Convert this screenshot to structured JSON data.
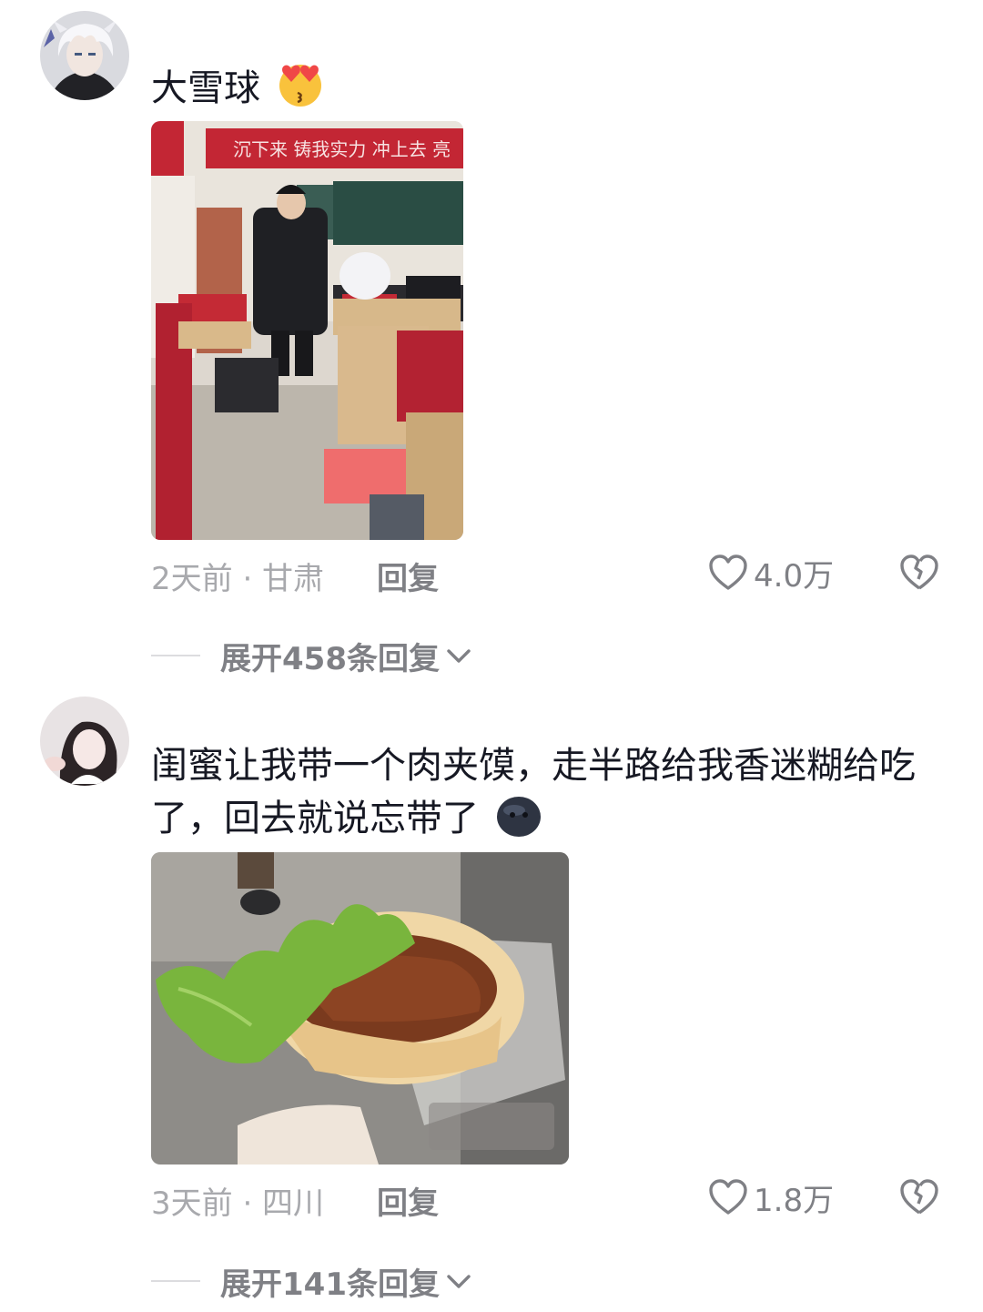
{
  "comments": [
    {
      "text": "大雪球",
      "emoji_icon": "kissing-heart-emoji",
      "time_location": "2天前 · 甘肃",
      "reply_label": "回复",
      "likes": "4.0万",
      "expand_label": "展开458条回复",
      "photo_banner": "沉下来 铸我实力 冲上去 亮"
    },
    {
      "text": "闺蜜让我带一个肉夹馍，走半路给我香迷糊给吃了，回去就说忘带了",
      "emoji_icon": "dark-blob-emoji",
      "time_location": "3天前 · 四川",
      "reply_label": "回复",
      "likes": "1.8万",
      "expand_label": "展开141条回复"
    }
  ],
  "icons": {
    "like": "heart-outline-icon",
    "dislike": "broken-heart-icon",
    "expand": "chevron-down-icon"
  },
  "colors": {
    "primary_text": "#161823",
    "meta_text": "#a8a9ad",
    "action_text": "#7f8085"
  }
}
